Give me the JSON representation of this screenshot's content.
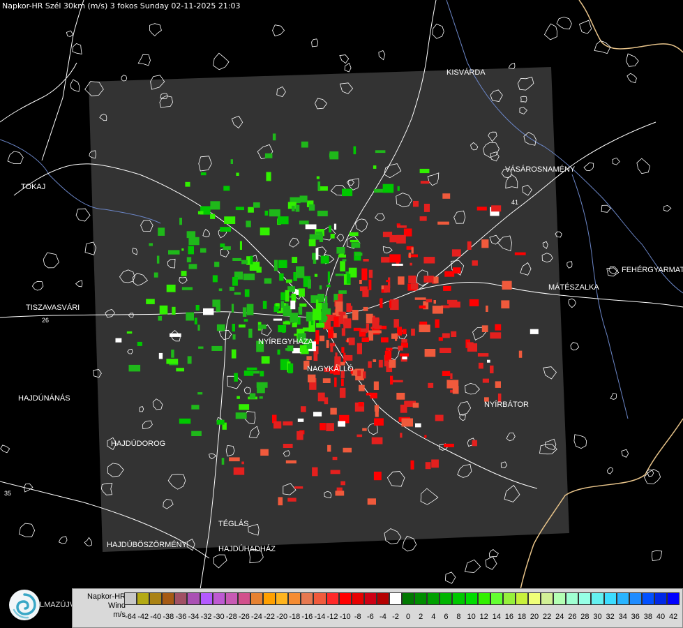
{
  "header": {
    "title": "Napkor-HR Szél 30km (m/s) 3 fokos Sunday 02-11-2025 21:03"
  },
  "map": {
    "background_color": "#000000",
    "coverage_color": "#333333",
    "road_color": "#ffffff",
    "river_color": "#6b86c8",
    "border_color": "#e8c48a",
    "receding_color": "#e4201e",
    "approaching_color": "#1fb81a",
    "places": [
      {
        "name": "KISVÁRDA"
      },
      {
        "name": "TOKAJ"
      },
      {
        "name": "VÁSÁROSNAMÉNY"
      },
      {
        "name": "FEHÉRGYARMAT"
      },
      {
        "name": "MÁTÉSZALKA"
      },
      {
        "name": "TISZAVASVÁRI"
      },
      {
        "name": "NYÍREGYHÁZA"
      },
      {
        "name": "NAGYKÁLLÓ"
      },
      {
        "name": "HAJDÚNÁNÁS"
      },
      {
        "name": "NYÍRBÁTOR"
      },
      {
        "name": "HAJDÚDOROG"
      },
      {
        "name": "TÉGLÁS"
      },
      {
        "name": "HAJDÚBÖSZÖRMÉNY"
      },
      {
        "name": "HAJDÚHADHÁZ"
      }
    ],
    "road_numbers": [
      {
        "label": "26"
      },
      {
        "label": "35"
      },
      {
        "label": "41"
      }
    ]
  },
  "logo": {
    "icon": "swirl-logo-icon",
    "text": "LMAZÚJVÁR"
  },
  "legend": {
    "line1": "Napkor-HR",
    "line2": "Wind",
    "line3": "m/s",
    "colors": [
      "#c8c8c8",
      "#b4aa14",
      "#aa8214",
      "#a55a14",
      "#a05064",
      "#aa50b4",
      "#b45aff",
      "#be5ad2",
      "#c85ab4",
      "#d2508c",
      "#e68232",
      "#ffa000",
      "#ffb41e",
      "#f58c32",
      "#e67850",
      "#f05a3c",
      "#ff2828",
      "#ff0000",
      "#e60000",
      "#cd0014",
      "#b40000",
      "#ffffff",
      "#007800",
      "#008c00",
      "#00a000",
      "#00b400",
      "#00c800",
      "#00dc00",
      "#32f000",
      "#64ff32",
      "#96f03c",
      "#c8f03c",
      "#f0ff78",
      "#d2f096",
      "#b4ffb4",
      "#a0ffd2",
      "#96ffe6",
      "#64f0f0",
      "#3cdcff",
      "#28b4ff",
      "#1e8cff",
      "#0050ff",
      "#0028e6",
      "#0000ff"
    ],
    "ticks": [
      "-64",
      "-42",
      "-40",
      "-38",
      "-36",
      "-34",
      "-32",
      "-30",
      "-28",
      "-26",
      "-24",
      "-22",
      "-20",
      "-18",
      "-16",
      "-14",
      "-12",
      "-10",
      "-8",
      "-6",
      "-4",
      "-2",
      "0",
      "2",
      "4",
      "6",
      "8",
      "10",
      "12",
      "14",
      "16",
      "18",
      "20",
      "22",
      "24",
      "26",
      "28",
      "30",
      "32",
      "34",
      "36",
      "38",
      "40",
      "42"
    ]
  }
}
